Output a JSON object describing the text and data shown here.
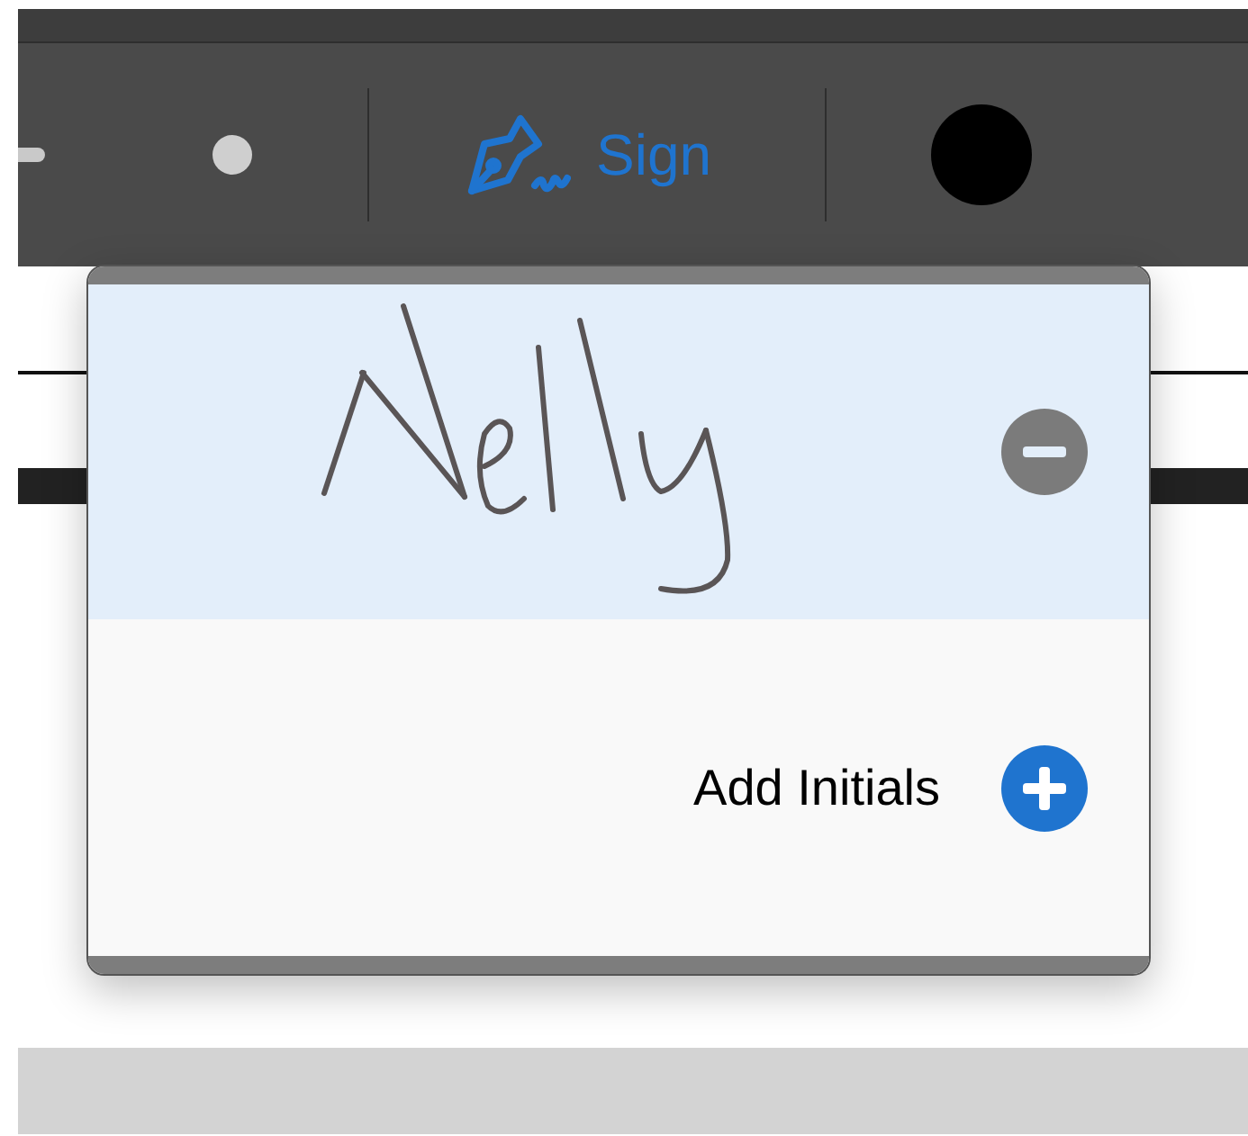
{
  "toolbar": {
    "sign_button": {
      "label": "Sign",
      "selected": true
    }
  },
  "signature_menu": {
    "signatures": [
      {
        "kind": "signature",
        "selected": true
      }
    ],
    "add_initials": {
      "label": "Add Initials"
    }
  }
}
